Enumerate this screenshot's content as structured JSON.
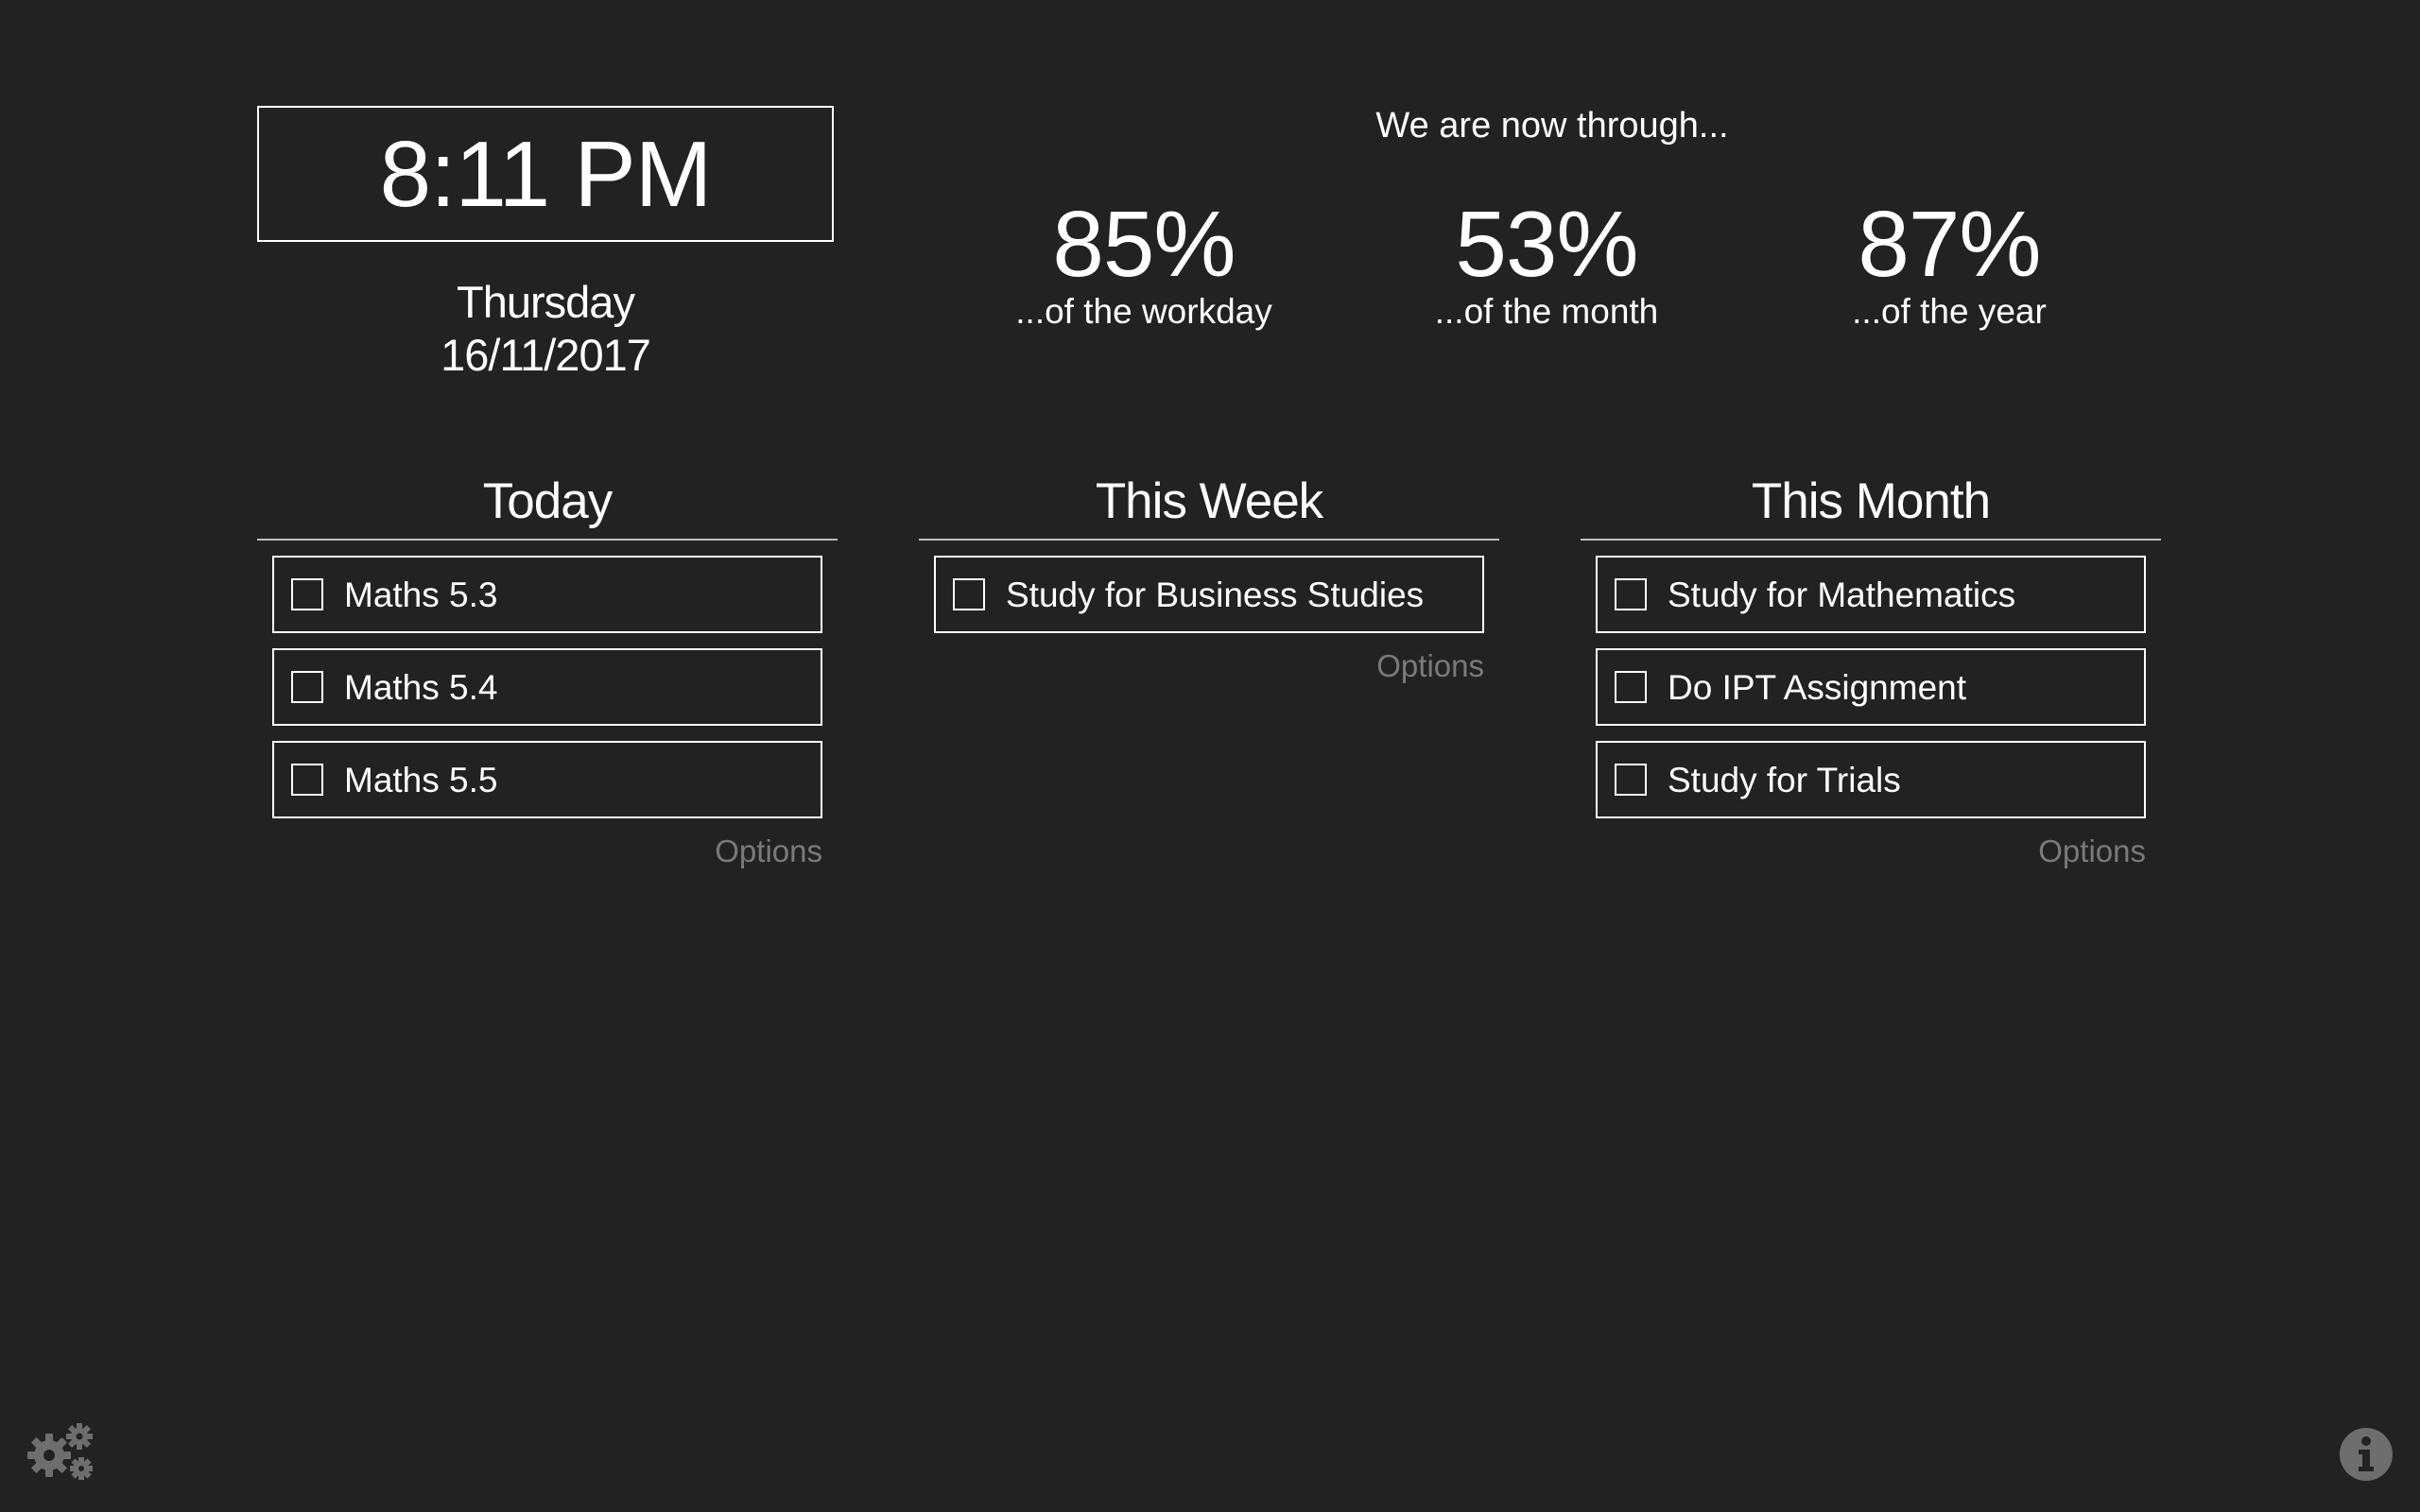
{
  "clock": {
    "time": "8:11 PM",
    "weekday": "Thursday",
    "date": "16/11/2017"
  },
  "progress": {
    "heading": "We are now through...",
    "stats": [
      {
        "value": "85%",
        "label": "...of the workday",
        "percent": 85
      },
      {
        "value": "53%",
        "label": "...of the month",
        "percent": 53
      },
      {
        "value": "87%",
        "label": "...of the year",
        "percent": 87
      }
    ]
  },
  "columns": [
    {
      "title": "Today",
      "tasks": [
        {
          "label": "Maths 5.3",
          "checked": false
        },
        {
          "label": "Maths 5.4",
          "checked": false
        },
        {
          "label": "Maths 5.5",
          "checked": false
        }
      ],
      "options_label": "Options"
    },
    {
      "title": "This Week",
      "tasks": [
        {
          "label": "Study for Business Studies",
          "checked": false
        }
      ],
      "options_label": "Options"
    },
    {
      "title": "This Month",
      "tasks": [
        {
          "label": "Study for Mathematics",
          "checked": false
        },
        {
          "label": "Do IPT Assignment",
          "checked": false
        },
        {
          "label": "Study for Trials",
          "checked": false
        }
      ],
      "options_label": "Options"
    }
  ],
  "icons": {
    "settings": "gear-icon",
    "info": "info-icon"
  },
  "colors": {
    "background": "#222222",
    "text": "#ffffff",
    "muted": "#7a7a7a",
    "icon": "#6e6e6e"
  }
}
